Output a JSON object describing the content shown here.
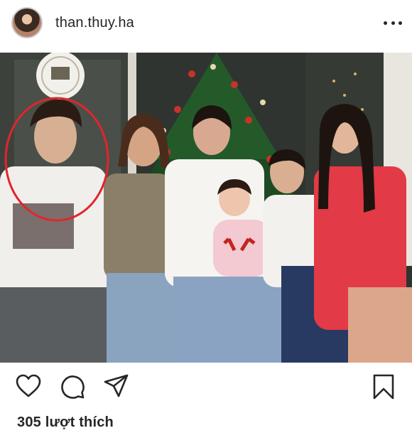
{
  "post": {
    "username": "than.thuy.ha",
    "likes_text": "305 lượt thích"
  },
  "icons": {
    "more": "more-options-icon",
    "like": "heart-icon",
    "comment": "comment-bubble-icon",
    "share": "paper-plane-icon",
    "save": "bookmark-icon"
  },
  "colors": {
    "text": "#262626",
    "highlight_circle": "#e0262b",
    "background": "#ffffff"
  }
}
